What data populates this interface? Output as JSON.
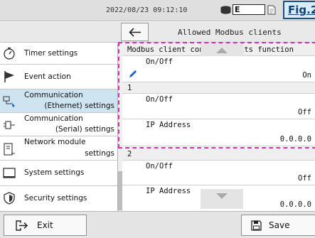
{
  "status": {
    "datetime": "2022/08/23 09:12:10",
    "storage_label": "E",
    "fig_label": "Fig.2"
  },
  "title": {
    "text": "Allowed Modbus clients"
  },
  "sidebar": {
    "items": [
      {
        "label1": "Timer settings",
        "label2": "",
        "icon": "stopwatch-icon"
      },
      {
        "label1": "Event action",
        "label2": "",
        "icon": "flag-icon"
      },
      {
        "label1": "Communication",
        "label2": "(Ethernet) settings",
        "icon": "ethernet-icon"
      },
      {
        "label1": "Communication",
        "label2": "(Serial) settings",
        "icon": "serial-plug-icon"
      },
      {
        "label1": "Network module",
        "label2": "settings",
        "icon": "network-module-icon"
      },
      {
        "label1": "System settings",
        "label2": "",
        "icon": "monitor-icon"
      },
      {
        "label1": "Security settings",
        "label2": "",
        "icon": "shield-icon"
      }
    ]
  },
  "main": {
    "header": "Modbus client connect limits function",
    "function_onoff": {
      "label": "On/Off",
      "value": "On"
    },
    "client1": {
      "index": "1",
      "onoff_label": "On/Off",
      "onoff_value": "Off",
      "ip_label": "IP Address",
      "ip_value": "0.0.0.0"
    },
    "client2": {
      "index": "2",
      "onoff_label": "On/Off",
      "onoff_value": "Off",
      "ip_label": "IP Address",
      "ip_value": "0.0.0.0"
    }
  },
  "footer": {
    "exit_label": "Exit",
    "save_label": "Save"
  },
  "colors": {
    "highlight": "#d62dbb",
    "active_item": "#cfe4f1",
    "fig_text": "#123f7a"
  }
}
